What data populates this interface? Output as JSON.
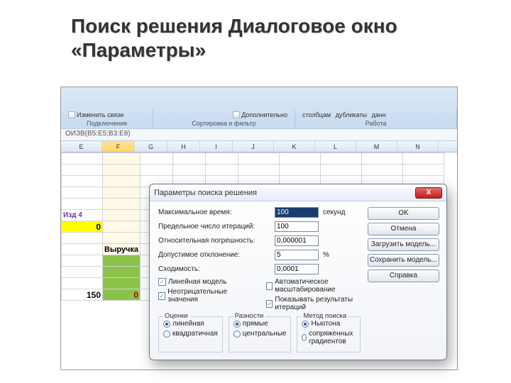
{
  "heading": "Поиск решения Диалоговое окно «Параметры»",
  "ribbon": {
    "edit": "Изменить связи",
    "g1": "Подключения",
    "sortfilter": "Сортировка и фильтр",
    "advanced": "Дополнительно",
    "g3a": "столбцам",
    "g3b": "дубликаты",
    "g3c": "данн",
    "g3lbl": "Работа"
  },
  "formula": "ОИЗВ(B5:E5;B3:E8)",
  "cols": [
    "E",
    "F",
    "G",
    "H",
    "I",
    "J",
    "K",
    "L",
    "M",
    "N"
  ],
  "sheet": {
    "izd4": "Изд 4",
    "zero": "0",
    "vyr": "Выручка",
    "n150": "150",
    "n0": "0"
  },
  "dialog": {
    "title": "Параметры поиска решения",
    "maxtime_l": "Максимальное время:",
    "maxtime_v": "100",
    "sec": "секунд",
    "iter_l": "Предельное число итераций:",
    "iter_v": "100",
    "prec_l": "Относительная погрешность:",
    "prec_v": "0,000001",
    "tol_l": "Допустимое отклонение:",
    "tol_v": "5",
    "pct": "%",
    "conv_l": "Сходимость:",
    "conv_v": "0,0001",
    "cb_lin": "Линейная модель",
    "cb_auto": "Автоматическое масштабирование",
    "cb_nonneg": "Неотрицательные значения",
    "cb_show": "Показывать результаты итераций",
    "grp_oc": "Оценки",
    "oc1": "линейная",
    "oc2": "квадратичная",
    "grp_rz": "Разности",
    "rz1": "прямые",
    "rz2": "центральные",
    "grp_mp": "Метод поиска",
    "mp1": "Ньютона",
    "mp2": "сопряженных градиентов",
    "btn_ok": "OK",
    "btn_cancel": "Отмена",
    "btn_load": "Загрузить модель...",
    "btn_save": "Сохранить модель...",
    "btn_help": "Справка"
  }
}
